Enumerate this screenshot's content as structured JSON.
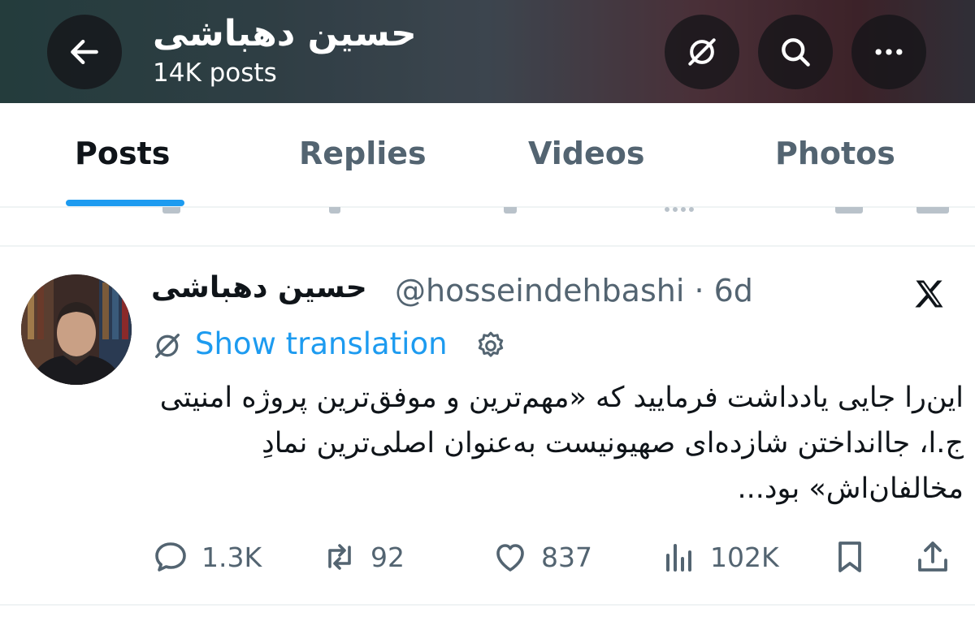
{
  "header": {
    "title": "حسین دهباشی",
    "post_count": "14K posts"
  },
  "tabs": [
    {
      "label": "Posts",
      "active": true
    },
    {
      "label": "Replies",
      "active": false
    },
    {
      "label": "Videos",
      "active": false
    },
    {
      "label": "Photos",
      "active": false
    }
  ],
  "tweet": {
    "author_name": "حسین دهباشی",
    "handle_time": "@hosseindehbashi · 6d",
    "show_translation": "Show translation",
    "text": "این‌را جایی یادداشت فرمایید که «مهم‌ترین و موفق‌ترین پروژه امنیتی ج.ا، جاانداختن شازده‌ای صهیونیست به‌عنوان اصلی‌ترین نمادِ مخالفان‌اش» بود...",
    "replies": "1.3K",
    "reposts": "92",
    "likes": "837",
    "views": "102K"
  },
  "colors": {
    "accent": "#1d9bf0",
    "secondary_text": "#536471",
    "primary_text": "#0f1419"
  },
  "icons": [
    "back-arrow-icon",
    "translate-icon",
    "search-icon",
    "more-icon",
    "x-logo-icon",
    "gear-icon",
    "reply-icon",
    "retweet-icon",
    "like-icon",
    "views-icon",
    "bookmark-icon",
    "share-icon"
  ]
}
